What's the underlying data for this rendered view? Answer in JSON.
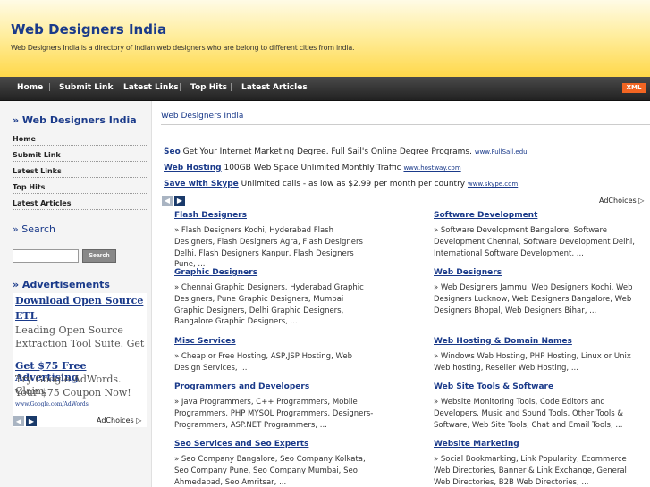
{
  "header": {
    "title": "Web Designers India",
    "description": "Web Designers India is a directory of indian web designers who are belong to different cities from india."
  },
  "nav": {
    "items": [
      "Home",
      "Submit Link",
      "Latest Links",
      "Top Hits",
      "Latest Articles"
    ],
    "separator": "|",
    "xml_badge": "XML"
  },
  "sidebar": {
    "heading": "» Web Designers India",
    "links": [
      "Home",
      "Submit Link",
      "Latest Links",
      "Top Hits",
      "Latest Articles"
    ],
    "search_heading": "» Search",
    "search_button": "Search",
    "ads_heading": "» Advertisements",
    "ads": [
      {
        "title_line1": "Download Open Source",
        "title_line2": "ETL",
        "text_line1": "Leading Open Source",
        "text_line2": "Extraction Tool Suite. Get"
      },
      {
        "title_line1": "Get $75 Free Advertising",
        "text_line1": "Try Google AdWords. Claim",
        "text_line2": "Your $75 Coupon Now!",
        "url": "www.Google.com/AdWords"
      }
    ],
    "adchoices": "AdChoices ▷"
  },
  "main": {
    "breadcrumb": "Web Designers India",
    "text_ads": [
      {
        "title": "Seo",
        "text": "Get Your Internet Marketing Degree. Full Sail's Online Degree Programs.",
        "url": "www.FullSail.edu"
      },
      {
        "title": "Web Hosting",
        "text": "100GB Web Space Unlimited Monthly Traffic",
        "url": "www.hostway.com"
      },
      {
        "title": "Save with Skype",
        "text": "Unlimited calls - as low as $2.99 per month per country",
        "url": "www.skype.com"
      }
    ],
    "adchoices": "AdChoices ▷",
    "arrows": {
      "left": "◀",
      "right": "▶"
    },
    "categories_left": [
      {
        "title": "Flash Designers",
        "desc": "» Flash Designers Kochi, Hyderabad Flash Designers, Flash Designers Agra, Flash Designers Delhi, Flash Designers Kanpur, Flash Designers Pune, ..."
      },
      {
        "title": "Graphic Designers",
        "desc": "» Chennai Graphic Designers, Hyderabad Graphic Designers, Pune Graphic Designers, Mumbai Graphic Designers, Delhi Graphic Designers, Bangalore Graphic Designers, ..."
      },
      {
        "title": "Misc Services",
        "desc": "» Cheap or Free Hosting, ASP,JSP Hosting, Web Design Services, ..."
      },
      {
        "title": "Programmers and Developers",
        "desc": "» Java Programmers, C++ Programmers, Mobile Programmers, PHP MYSQL Programmers, Designers-Programmers, ASP.NET Programmers, ..."
      },
      {
        "title": "Seo Services and Seo Experts",
        "desc": "» Seo Company Bangalore, Seo Company Kolkata, Seo Company Pune, Seo Company Mumbai, Seo Ahmedabad, Seo Amritsar, ..."
      }
    ],
    "categories_right": [
      {
        "title": "Software Development",
        "desc": "» Software Development Bangalore, Software Development Chennai, Software Development Delhi, International Software Development, ..."
      },
      {
        "title": "Web Designers",
        "desc": "» Web Designers Jammu, Web Designers Kochi, Web Designers Lucknow, Web Designers Bangalore, Web Designers Bhopal, Web Designers Bihar, ..."
      },
      {
        "title": "Web Hosting & Domain Names",
        "desc": "» Windows Web Hosting, PHP Hosting, Linux or Unix Web hosting, Reseller Web Hosting, ..."
      },
      {
        "title": "Web Site Tools & Software",
        "desc": "» Website Monitoring Tools, Code Editors and Developers, Music and Sound Tools, Other Tools & Software, Web Site Tools, Chat and Email Tools, ..."
      },
      {
        "title": "Website Marketing",
        "desc": "» Social Bookmarking, Link Popularity, Ecommerce Web Directories, Banner & Link Exchange, General Web Directories, B2B Web Directories, ..."
      }
    ]
  }
}
